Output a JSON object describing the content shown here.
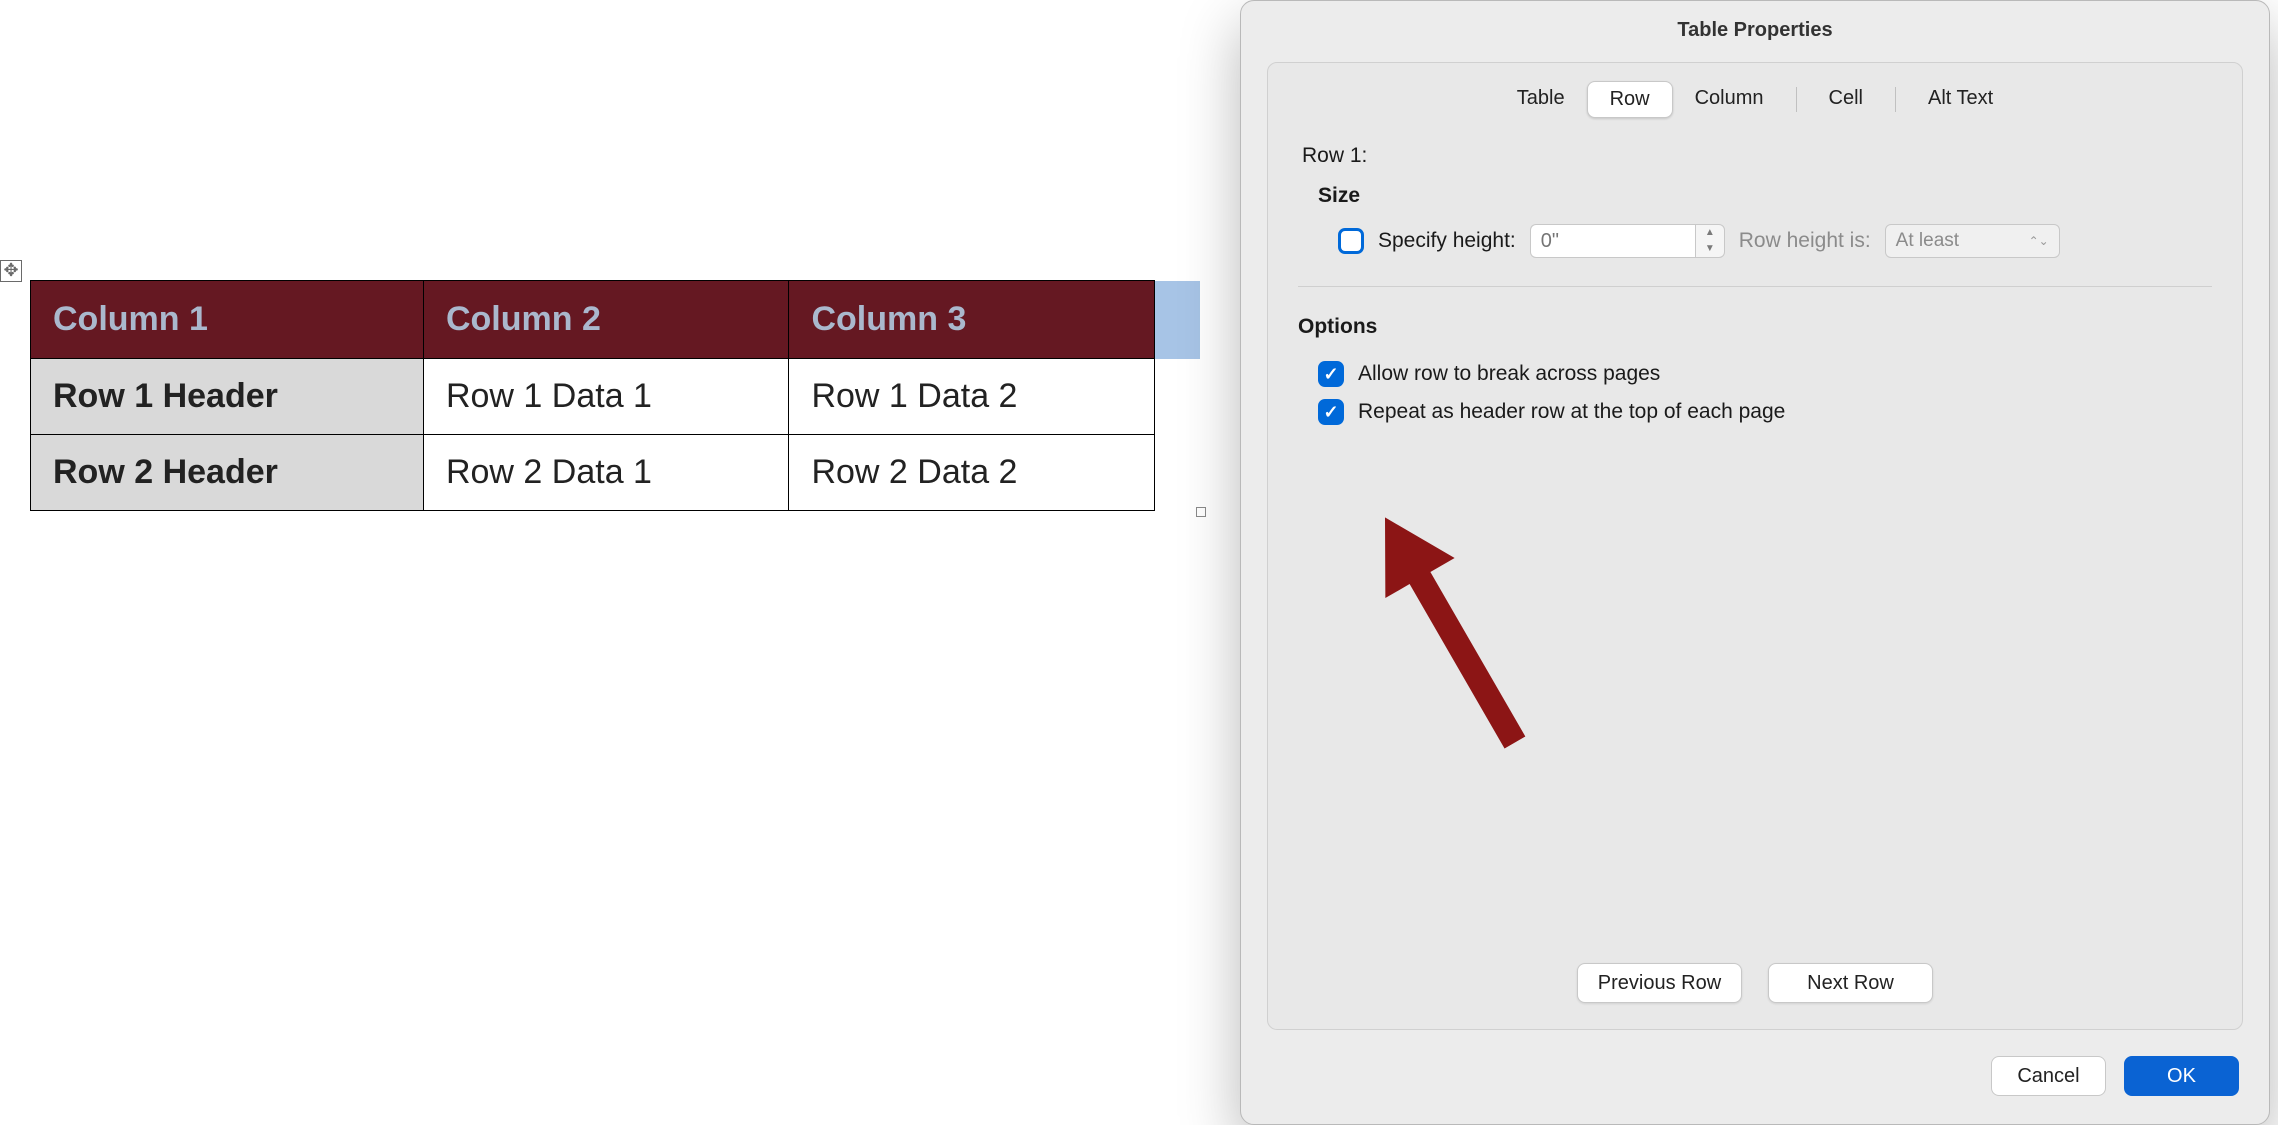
{
  "doc_table": {
    "headers": [
      "Column 1",
      "Column 2",
      "Column 3"
    ],
    "rows": [
      {
        "header": "Row 1 Header",
        "cells": [
          "Row 1 Data 1",
          "Row 1 Data 2"
        ]
      },
      {
        "header": "Row 2 Header",
        "cells": [
          "Row 2 Data 1",
          "Row 2 Data 2"
        ]
      }
    ]
  },
  "dialog": {
    "title": "Table Properties",
    "tabs": {
      "table": "Table",
      "row": "Row",
      "column": "Column",
      "cell": "Cell",
      "alttext": "Alt Text",
      "active": "row"
    },
    "row_panel": {
      "row_indicator": "Row 1:",
      "size_heading": "Size",
      "specify_height_label": "Specify height:",
      "specify_height_checked": false,
      "height_value": "",
      "height_placeholder": "0\"",
      "row_height_is_label": "Row height is:",
      "row_height_is_value": "At least",
      "options_heading": "Options",
      "allow_break_label": "Allow row to break across pages",
      "allow_break_checked": true,
      "repeat_header_label": "Repeat as header row at the top of each page",
      "repeat_header_checked": true,
      "previous_row_label": "Previous Row",
      "next_row_label": "Next Row"
    },
    "footer": {
      "cancel": "Cancel",
      "ok": "OK"
    }
  }
}
